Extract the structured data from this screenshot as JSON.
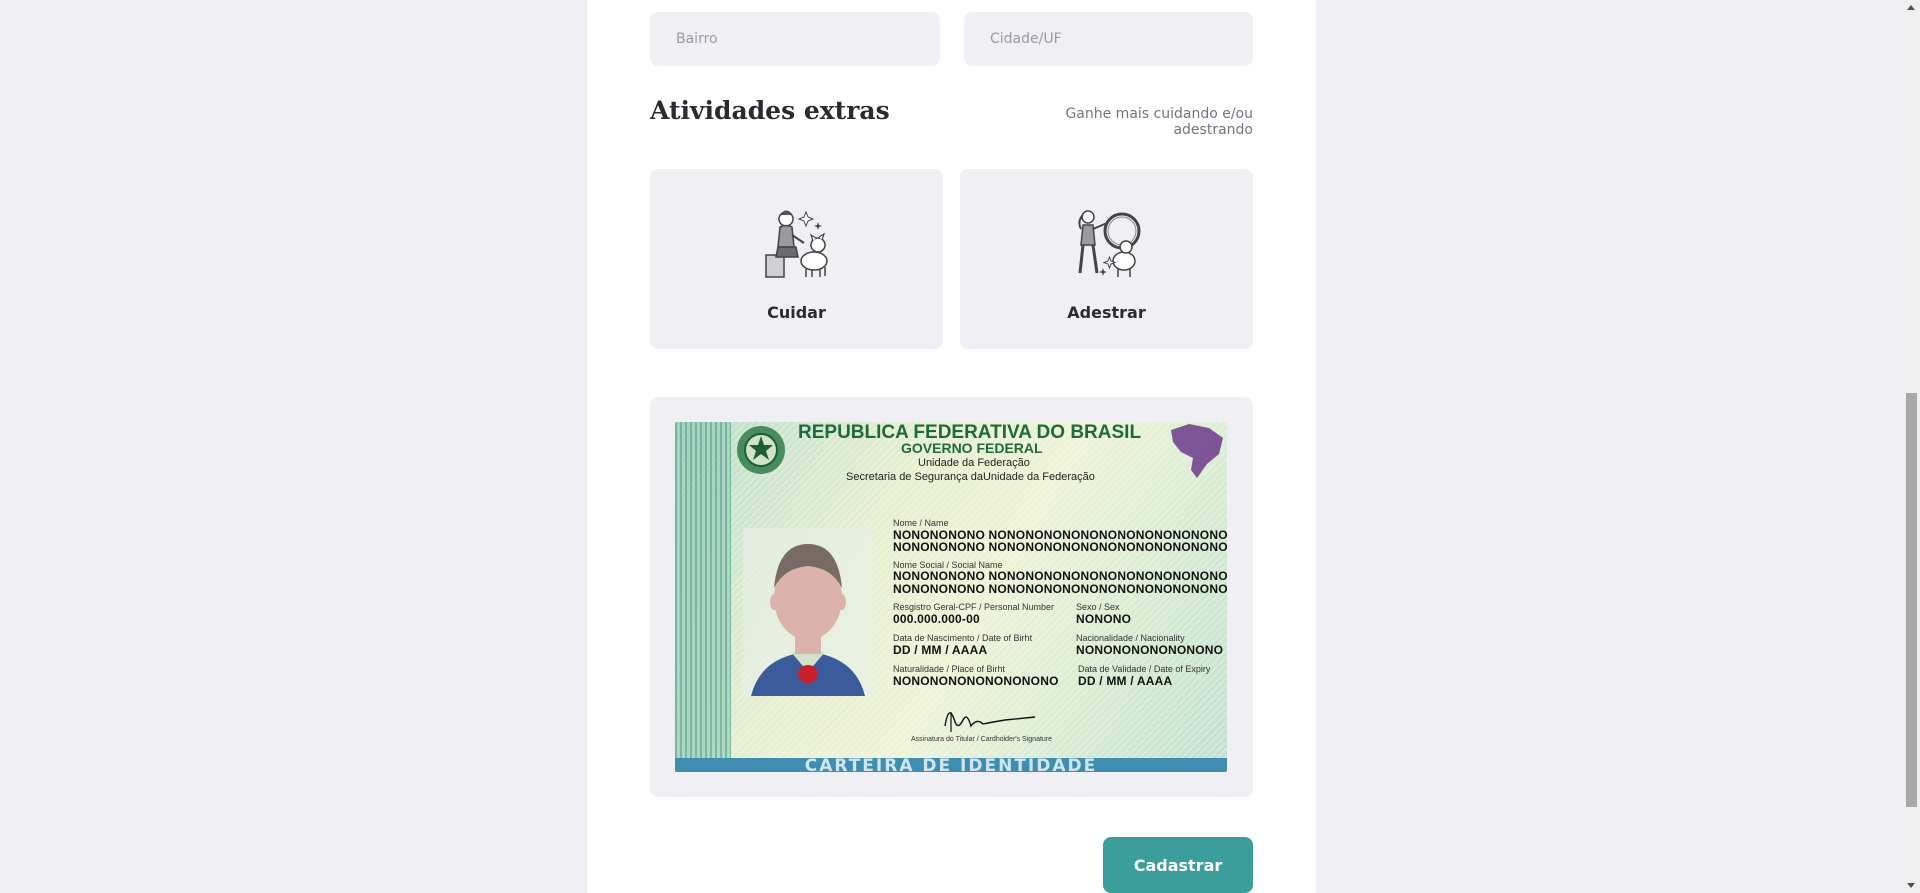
{
  "address": {
    "bairro_placeholder": "Bairro",
    "cidade_placeholder": "Cidade/UF"
  },
  "extras": {
    "title": "Atividades extras",
    "hint": "Ganhe mais cuidando e/ou adestrando",
    "options": [
      {
        "label": "Cuidar",
        "icon": "pet-care-icon"
      },
      {
        "label": "Adestrar",
        "icon": "dog-training-icon"
      }
    ]
  },
  "document": {
    "header": "REPUBLICA FEDERATIVA DO BRASIL",
    "government": "GOVERNO FEDERAL",
    "unit": "Unidade da Federação",
    "secretariat": "Secretaria de Segurança daUnidade da Federação",
    "name_label": "Nome / Name",
    "name_line1": "NONONONONO NONONONONONONONONONONONONONO",
    "name_line2": "NONONONONO NONONONONONONONONONONONONONO",
    "social_name_label": "Nome Social / Social Name",
    "social_name_line1": "NONONONONO NONONONONONONONONONONONONONO",
    "social_name_line2": "NONONONONO NONONONONONONONONONONONONONO",
    "cpf_label": "Resgistro Geral-CPF / Personal Number",
    "cpf_value": "000.000.000-00",
    "sex_label": "Sexo / Sex",
    "sex_value": "NONONO",
    "birth_label": "Data de Nascimento / Date of Birht",
    "birth_value": "DD / MM / AAAA",
    "nationality_label": "Nacionalidade / Nacionality",
    "nationality_value": "NONONONONONONONO",
    "place_label": "Naturalidade / Place of Birht",
    "place_value": "NONONONONONONONONO",
    "expiry_label": "Data de Validade / Date of Expiry",
    "expiry_value": "DD / MM / AAAA",
    "signature_label": "Assinatura do Titular / Cardholder's Signature",
    "footer_text": "CARTEIRA DE IDENTIDADE"
  },
  "actions": {
    "submit_label": "Cadastrar"
  },
  "colors": {
    "page_bg": "#f0eff4",
    "panel_bg": "#ffffff",
    "accent": "#3c9e9b",
    "field_bg": "#f0eff4"
  }
}
